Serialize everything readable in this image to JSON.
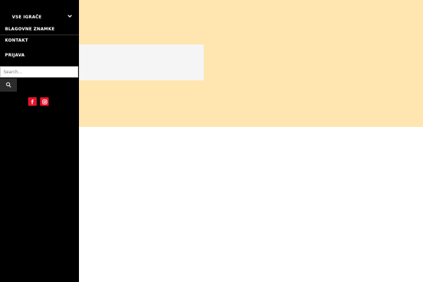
{
  "sidebar": {
    "menu": [
      {
        "label": "VSE IGRAČE",
        "has_submenu": true,
        "icon": "chevron-down-icon"
      },
      {
        "label": "BLAGOVNE ZNAMKE"
      },
      {
        "label": "KONTAKT"
      },
      {
        "label": "PRIJAVA"
      }
    ],
    "search": {
      "placeholder": "Search...",
      "value": "",
      "button_icon": "search-icon"
    },
    "social": [
      {
        "name": "facebook",
        "icon": "facebook-icon"
      },
      {
        "name": "instagram",
        "icon": "instagram-icon"
      }
    ]
  },
  "colors": {
    "sidebar_bg": "#000000",
    "hero_bg": "#ffe5af",
    "hero_box_bg": "#f5f5f5",
    "social_accent": "#e8122b",
    "search_button_bg": "#2b2b2b"
  }
}
